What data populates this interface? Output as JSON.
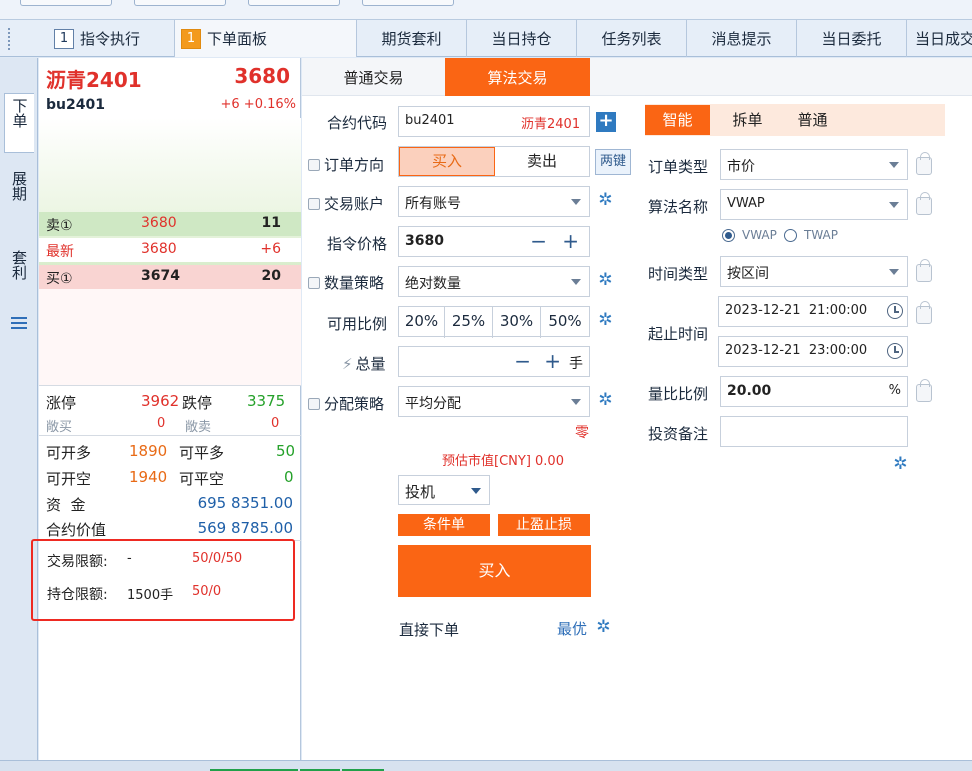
{
  "tabs": [
    {
      "num": "1",
      "label": "指令执行",
      "num_style": "blue"
    },
    {
      "num": "1",
      "label": "下单面板",
      "num_style": "orange"
    },
    {
      "label": "期货套利"
    },
    {
      "label": "当日持仓"
    },
    {
      "label": "任务列表"
    },
    {
      "label": "消息提示"
    },
    {
      "label": "当日委托"
    },
    {
      "label": "当日成交"
    }
  ],
  "side_tabs": [
    "下单",
    "展期",
    "套利"
  ],
  "quote": {
    "name": "沥青2401",
    "price": "3680",
    "code": "bu2401",
    "change": "+6 +0.16%",
    "sell1": {
      "label": "卖①",
      "price": "3680",
      "vol": "11"
    },
    "latest": {
      "label": "最新",
      "price": "3680",
      "vol": "+6"
    },
    "buy1": {
      "label": "买①",
      "price": "3674",
      "vol": "20"
    },
    "limit_up_label": "涨停",
    "limit_up": "3962",
    "limit_down_label": "跌停",
    "limit_down": "3375",
    "pos_buy_label": "敞买",
    "pos_buy": "0",
    "pos_sell_label": "敞卖",
    "pos_sell": "0",
    "can_open_long_label": "可开多",
    "can_open_long": "1890",
    "can_close_long_label": "可平多",
    "can_close_long": "50",
    "can_open_short_label": "可开空",
    "can_open_short": "1940",
    "can_close_short_label": "可平空",
    "can_close_short": "0",
    "funds_label": "资  金",
    "funds": "695 8351.00",
    "contract_value_label": "合约价值",
    "contract_value": "569 8785.00",
    "trade_limit_label": "交易限额:",
    "trade_limit_val": "-",
    "trade_limit_nums": "50/0/50",
    "pos_limit_label": "持仓限额:",
    "pos_limit_val": "1500手",
    "pos_limit_nums": "50/0"
  },
  "order": {
    "subtabs": [
      "普通交易",
      "算法交易"
    ],
    "contract_label": "合约代码",
    "contract_code": "bu2401",
    "contract_name": "沥青2401",
    "direction_label": "订单方向",
    "buy_label": "买入",
    "sell_label": "卖出",
    "two_way_label": "两键",
    "account_label": "交易账户",
    "account_value": "所有账号",
    "price_label": "指令价格",
    "price_value": "3680",
    "qty_strategy_label": "数量策略",
    "qty_strategy_value": "绝对数量",
    "ratio_label": "可用比例",
    "ratios": [
      "20%",
      "25%",
      "30%",
      "50%"
    ],
    "total_label": "总量",
    "total_unit": "手",
    "alloc_label": "分配策略",
    "alloc_value": "平均分配",
    "zero_text": "零",
    "est_value": "预估市值[CNY] 0.00",
    "speculation": "投机",
    "cond_order": "条件单",
    "stop_order": "止盈止损",
    "submit": "买入",
    "direct_label": "直接下单",
    "best_label": "最优"
  },
  "algo": {
    "modes": [
      "智能",
      "拆单",
      "普通"
    ],
    "order_type_label": "订单类型",
    "order_type_value": "市价",
    "algo_name_label": "算法名称",
    "algo_name_value": "VWAP",
    "radio_vwap": "VWAP",
    "radio_twap": "TWAP",
    "time_type_label": "时间类型",
    "time_type_value": "按区间",
    "start_end_label": "起止时间",
    "start_time": "2023-12-21  21:00:00",
    "end_time": "2023-12-21  23:00:00",
    "vol_ratio_label": "量比比例",
    "vol_ratio_value": "20.00",
    "vol_ratio_unit": "%",
    "remark_label": "投资备注",
    "remark_value": ""
  },
  "colors": {
    "accent": "#fa6514",
    "red": "#e0312b",
    "green": "#25a12a",
    "blue": "#1e5fa8"
  }
}
